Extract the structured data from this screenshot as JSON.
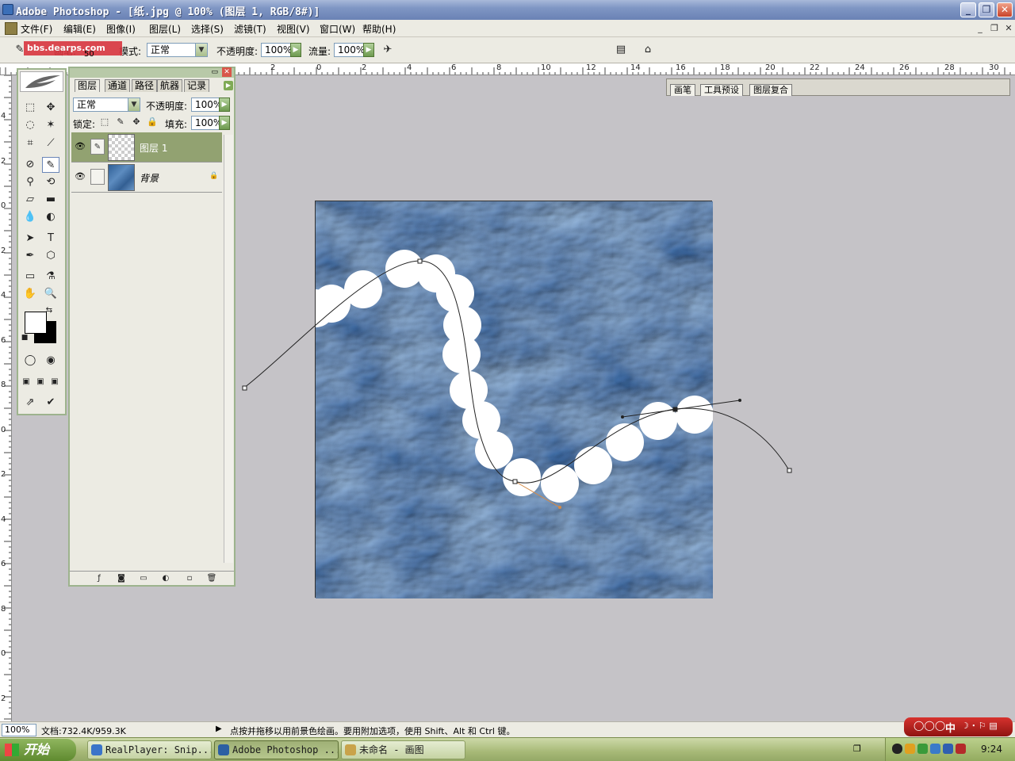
{
  "window": {
    "title": "Adobe Photoshop - [纸.jpg @ 100% (图层 1, RGB/8#)]",
    "minimize": "_",
    "restore": "❐",
    "close": "✕"
  },
  "menu": {
    "items": [
      "文件(F)",
      "编辑(E)",
      "图像(I)",
      "图层(L)",
      "选择(S)",
      "滤镜(T)",
      "视图(V)",
      "窗口(W)",
      "帮助(H)"
    ]
  },
  "options": {
    "tool_label": "画笔:",
    "brush_size": "50",
    "mode_label": "模式:",
    "mode_value": "正常",
    "opacity_label": "不透明度:",
    "opacity_value": "100%",
    "flow_label": "流量:",
    "flow_value": "100%",
    "watermark": "bbs.dearps.com",
    "well_tabs": [
      "画笔",
      "工具预设",
      "图层复合"
    ]
  },
  "ruler": {
    "top_labels": [
      "2",
      "0",
      "2",
      "4",
      "6",
      "8",
      "10",
      "12",
      "14",
      "16",
      "18",
      "20",
      "22",
      "24",
      "26",
      "28",
      "30"
    ],
    "left_labels": [
      "4",
      "2",
      "0",
      "2",
      "4",
      "6",
      "8",
      "0",
      "2",
      "4",
      "6",
      "8",
      "0",
      "2"
    ]
  },
  "layers_panel": {
    "tabs": [
      "图层",
      "通道",
      "路径",
      "航器",
      "记录"
    ],
    "blend_mode": "正常",
    "opacity_label": "不透明度:",
    "opacity_value": "100%",
    "lock_label": "锁定:",
    "fill_label": "填充:",
    "fill_value": "100%",
    "layers": [
      {
        "name": "图层 1",
        "selected": true
      },
      {
        "name": "背景",
        "selected": false
      }
    ]
  },
  "status": {
    "zoom": "100%",
    "doc_info": "文档:732.4K/959.3K",
    "hint": "点按并拖移以用前景色绘画。要用附加选项，使用 Shift、Alt 和 Ctrl 键。",
    "ime": "中"
  },
  "taskbar": {
    "start": "开始",
    "tasks": [
      "RealPlayer: Snip...",
      "Adobe Photoshop ...",
      "未命名 - 画图"
    ],
    "clock": "9:24"
  },
  "colors": {
    "accent_green": "#92a271",
    "paper_blue": "#3e6fa8",
    "title_blue": "#7f96c4",
    "brush_white": "#ffffff"
  }
}
